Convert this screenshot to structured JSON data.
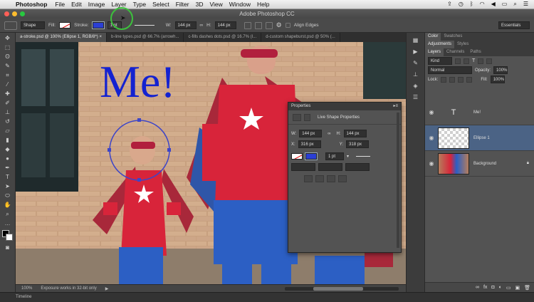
{
  "menubar": {
    "app": "Photoshop",
    "items": [
      "File",
      "Edit",
      "Image",
      "Layer",
      "Type",
      "Select",
      "Filter",
      "3D",
      "View",
      "Window",
      "Help"
    ]
  },
  "window": {
    "title": "Adobe Photoshop CC"
  },
  "options": {
    "tool_mode": "Shape",
    "fill_label": "Fill:",
    "stroke_label": "Stroke:",
    "stroke_size": "1 pt",
    "w_label": "W:",
    "w_value": "144 px",
    "h_label": "H:",
    "h_value": "144 px",
    "align_edges": "Align Edges",
    "workspace": "Essentials"
  },
  "tabs": [
    "a-stroke.psd @ 100% (Ellipse 1, RGB/8*) ×",
    "b-line types.psd @ 66.7% (arrowh...",
    "c-fills dashes dots.psd @ 16.7% (I...",
    "d-custom shapeburst.psd @ 50% (..."
  ],
  "canvas": {
    "headline": "Me!"
  },
  "status": {
    "zoom": "100%",
    "message": "Exposure works in 32-bit only"
  },
  "timeline": {
    "label": "Timeline"
  },
  "properties": {
    "title": "Properties",
    "subtitle": "Live Shape Properties",
    "w_label": "W:",
    "w_value": "144 px",
    "h_label": "H:",
    "h_value": "144 px",
    "x_label": "X:",
    "x_value": "316 px",
    "y_label": "Y:",
    "y_value": "318 px",
    "stroke_size": "1 pt"
  },
  "panels": {
    "top_tabs": [
      "Color",
      "Swatches"
    ],
    "mid_tabs": [
      "Adjustments",
      "Styles"
    ],
    "layer_tabs": [
      "Layers",
      "Channels",
      "Paths"
    ],
    "kind": "Kind",
    "blend": "Normal",
    "opacity_label": "Opacity:",
    "opacity": "100%",
    "lock_label": "Lock:",
    "fill_label": "Fill:",
    "fill": "100%",
    "layers": [
      {
        "name": "Me!",
        "kind": "text"
      },
      {
        "name": "Ellipse 1",
        "kind": "shape"
      },
      {
        "name": "Background",
        "kind": "image"
      }
    ]
  }
}
